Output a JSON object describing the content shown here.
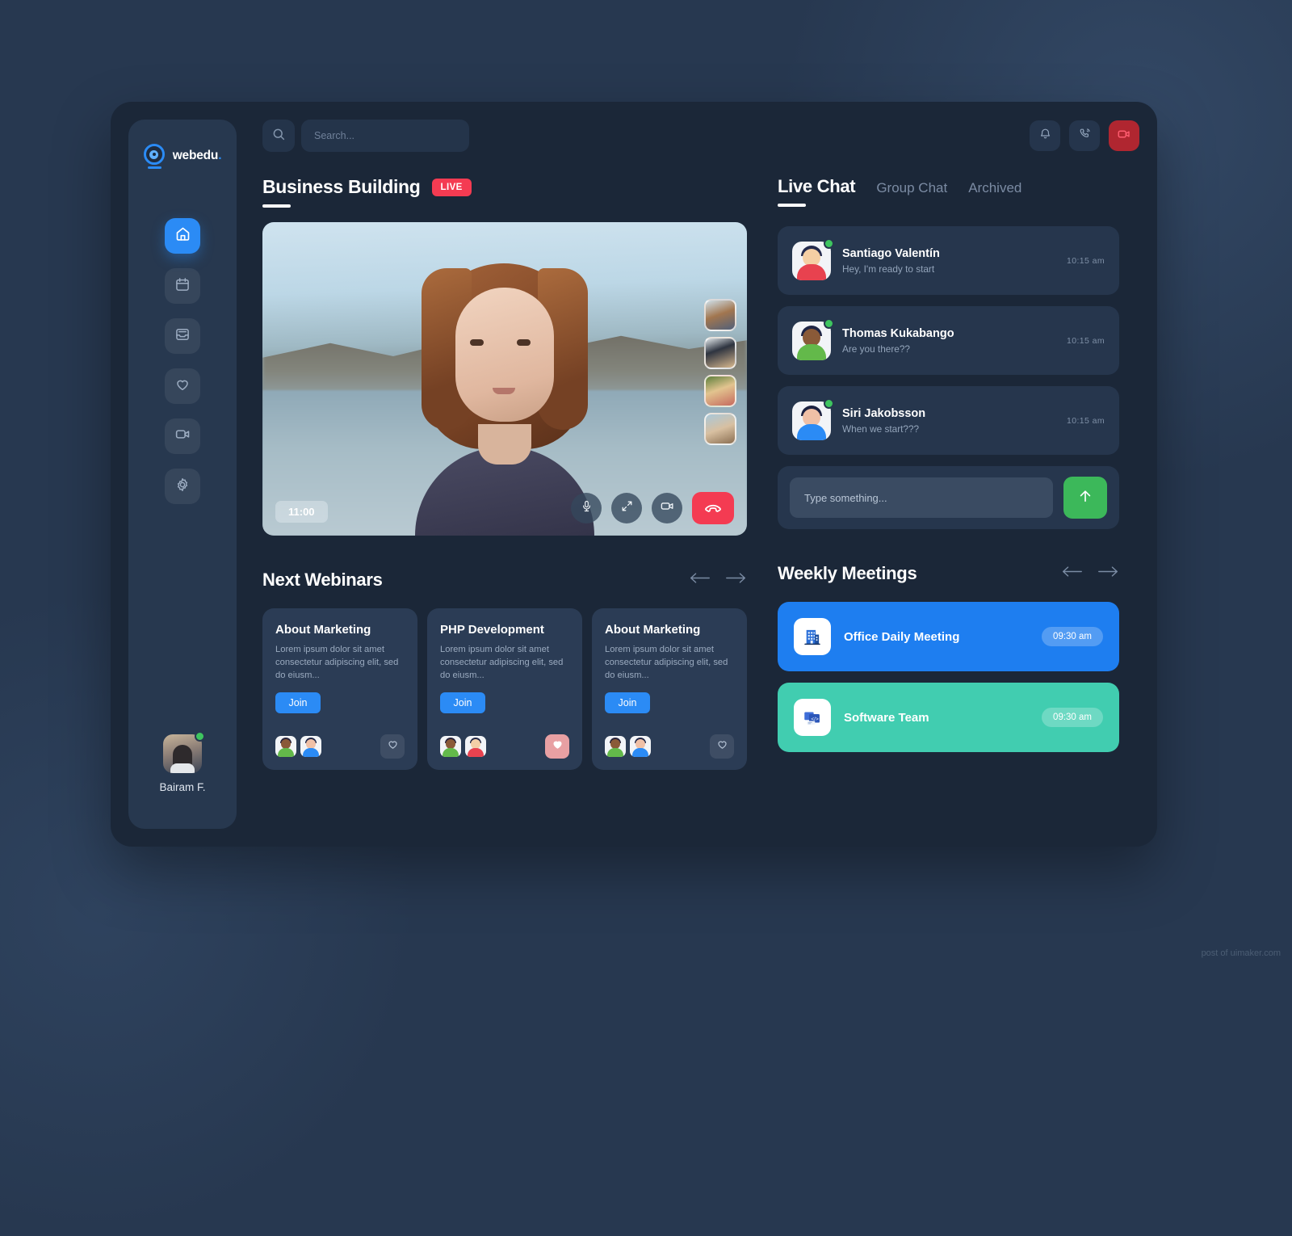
{
  "brand": {
    "name": "webedu",
    "dot": "."
  },
  "search": {
    "placeholder": "Search...",
    "icon": "search-icon"
  },
  "topbar_actions": [
    {
      "name": "notifications",
      "icon": "bell-icon"
    },
    {
      "name": "calls",
      "icon": "phone-ring-icon"
    },
    {
      "name": "video",
      "icon": "video-camera-icon"
    }
  ],
  "sidebar": {
    "items": [
      {
        "label": "Home",
        "icon": "home-icon",
        "active": true
      },
      {
        "label": "Calendar",
        "icon": "calendar-icon",
        "active": false
      },
      {
        "label": "Inbox",
        "icon": "inbox-icon",
        "active": false
      },
      {
        "label": "Favorites",
        "icon": "heart-icon",
        "active": false
      },
      {
        "label": "Meetings",
        "icon": "video-camera-icon",
        "active": false
      },
      {
        "label": "Settings",
        "icon": "gear-icon",
        "active": false
      }
    ],
    "profile": {
      "name": "Bairam F.",
      "status": "online"
    }
  },
  "stream": {
    "title": "Business Building",
    "badge": "LIVE",
    "timestamp": "11:00",
    "controls": [
      {
        "name": "microphone",
        "icon": "microphone-icon"
      },
      {
        "name": "expand",
        "icon": "expand-icon"
      },
      {
        "name": "camera",
        "icon": "video-camera-icon"
      },
      {
        "name": "end-call",
        "icon": "phone-hangup-icon"
      }
    ],
    "participants": [
      {
        "name": "participant-1"
      },
      {
        "name": "participant-2"
      },
      {
        "name": "participant-3"
      },
      {
        "name": "participant-4"
      }
    ]
  },
  "webinars": {
    "title": "Next Webinars",
    "prev_icon": "arrow-left-icon",
    "next_icon": "arrow-right-icon",
    "cards": [
      {
        "title": "About Marketing",
        "desc": "Lorem ipsum dolor sit amet consectetur adipiscing elit, sed do eiusm...",
        "join_label": "Join",
        "liked": false
      },
      {
        "title": "PHP Development",
        "desc": "Lorem ipsum dolor sit amet consectetur adipiscing elit, sed do eiusm...",
        "join_label": "Join",
        "liked": true
      },
      {
        "title": "About Marketing",
        "desc": "Lorem ipsum dolor sit amet consectetur adipiscing elit, sed do eiusm...",
        "join_label": "Join",
        "liked": false
      }
    ]
  },
  "chat": {
    "tabs": [
      {
        "label": "Live Chat",
        "active": true
      },
      {
        "label": "Group Chat",
        "active": false
      },
      {
        "label": "Archived",
        "active": false
      }
    ],
    "messages": [
      {
        "name": "Santiago Valentín",
        "preview": "Hey, I'm ready to start",
        "time": "10:15  am",
        "status": "online"
      },
      {
        "name": "Thomas Kukabango",
        "preview": "Are you there??",
        "time": "10:15  am",
        "status": "online"
      },
      {
        "name": "Siri Jakobsson",
        "preview": "When we start???",
        "time": "10:15  am",
        "status": "online"
      }
    ],
    "composer": {
      "placeholder": "Type something...",
      "send_icon": "arrow-up-icon"
    }
  },
  "meetings": {
    "title": "Weekly Meetings",
    "prev_icon": "arrow-left-icon",
    "next_icon": "arrow-right-icon",
    "items": [
      {
        "name": "Office Daily Meeting",
        "time": "09:30 am",
        "icon": "office-building-icon",
        "color": "#1e7ef0"
      },
      {
        "name": "Software Team",
        "time": "09:30 am",
        "icon": "code-window-icon",
        "color": "#41cdb0"
      }
    ]
  },
  "watermark": "post of uimaker.com",
  "colors": {
    "accent_blue": "#2b8bf5",
    "live_red": "#f43b52",
    "send_green": "#3cb85a",
    "teal": "#41cdb0",
    "panel": "#1b2738",
    "sidebar": "#27384f",
    "card": "#2b3c55"
  }
}
